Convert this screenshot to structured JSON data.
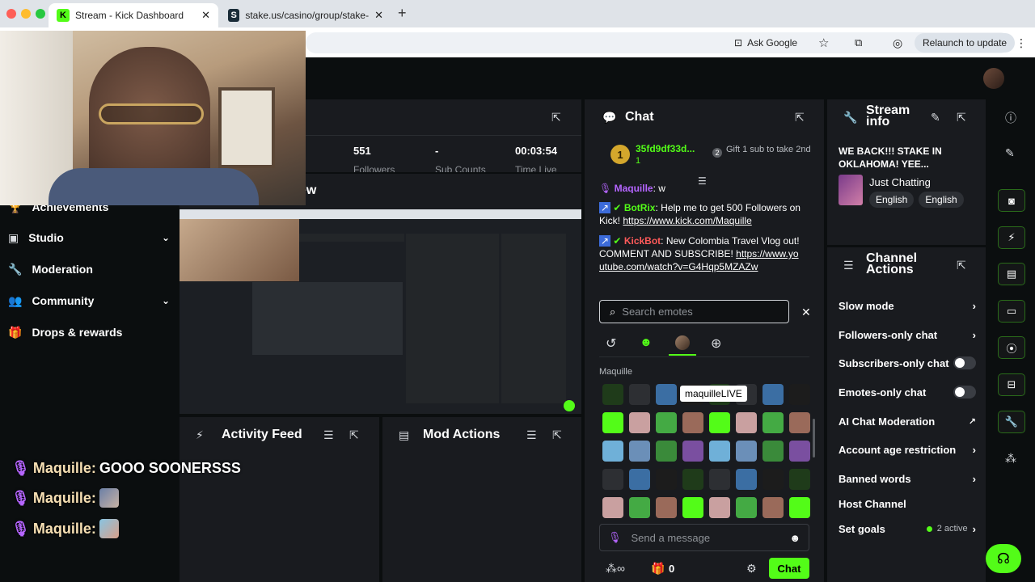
{
  "browser": {
    "tabs": [
      {
        "label": "Stream - Kick Dashboard",
        "active": true,
        "favicon": "kick-logo"
      },
      {
        "label": "stake.us/casino/group/stake-",
        "active": false,
        "favicon": "stake-logo"
      }
    ],
    "new_tab": "+",
    "ask_google": "Ask Google",
    "relaunch": "Relaunch to update"
  },
  "sidebar": {
    "items": [
      {
        "label": "Achievements",
        "icon": "trophy-icon"
      },
      {
        "label": "Studio",
        "icon": "studio-icon",
        "expandable": true
      },
      {
        "label": "Moderation",
        "icon": "wrench-icon"
      },
      {
        "label": "Community",
        "icon": "users-icon",
        "expandable": true
      },
      {
        "label": "Drops & rewards",
        "icon": "gift-icon"
      }
    ]
  },
  "stats": {
    "partial_title": "ew",
    "followers": "551",
    "followers_label": "Followers",
    "sub_count": "-",
    "sub_label": "Sub Counts",
    "time_live": "00:03:54",
    "time_label": "Time Live"
  },
  "activity_feed": {
    "title": "Activity Feed"
  },
  "mod_actions": {
    "title": "Mod Actions"
  },
  "overlay_chat": [
    {
      "user": "Maquille:",
      "text": "GOOO SOONERSSS"
    },
    {
      "user": "Maquille:",
      "text": ""
    },
    {
      "user": "Maquille:",
      "text": ""
    }
  ],
  "chat": {
    "title": "Chat",
    "pinned_user": "35fd9df33d...",
    "pinned_count": "1",
    "gift_rank": "2",
    "gift_text": "Gift 1 sub to take 2nd",
    "partial_msg_user": "Maquille",
    "partial_msg_text": "w",
    "messages": [
      {
        "user": "BotRix",
        "text": "Help me to get 500 Followers on Kick!",
        "link": "https://www.kick.com/Maquille"
      },
      {
        "user": "KickBot",
        "text": "New Colombia Travel Vlog out! COMMENT AND SUBSCRIBE!",
        "link": "https://www.youtube.com/watch?v=G4Hqp5MZAZw"
      }
    ],
    "emote_search_placeholder": "Search emotes",
    "emote_section": "Maquille",
    "tooltip": "maquilleLIVE",
    "send_placeholder": "Send a message",
    "points": "0",
    "chat_button": "Chat"
  },
  "stream_info": {
    "title": "Stream info",
    "stream_title": "WE BACK!!! STAKE IN OKLAHOMA! YEE...",
    "category": "Just Chatting",
    "tags": [
      "English",
      "English"
    ]
  },
  "channel_actions": {
    "title": "Channel Actions",
    "rows": [
      {
        "label": "Slow mode",
        "control": "chevron"
      },
      {
        "label": "Followers-only chat",
        "control": "chevron"
      },
      {
        "label": "Subscribers-only chat",
        "control": "toggle"
      },
      {
        "label": "Emotes-only chat",
        "control": "toggle"
      },
      {
        "label": "AI Chat Moderation",
        "control": "external"
      },
      {
        "label": "Account age restriction",
        "control": "chevron"
      },
      {
        "label": "Banned words",
        "control": "chevron"
      },
      {
        "label": "Host Channel",
        "control": "none"
      },
      {
        "label": "Set goals",
        "control": "chevron",
        "badge": "2 active"
      }
    ]
  },
  "colors": {
    "accent": "#53fc18",
    "panel": "#191b1f",
    "bg": "#0b0e0f"
  }
}
